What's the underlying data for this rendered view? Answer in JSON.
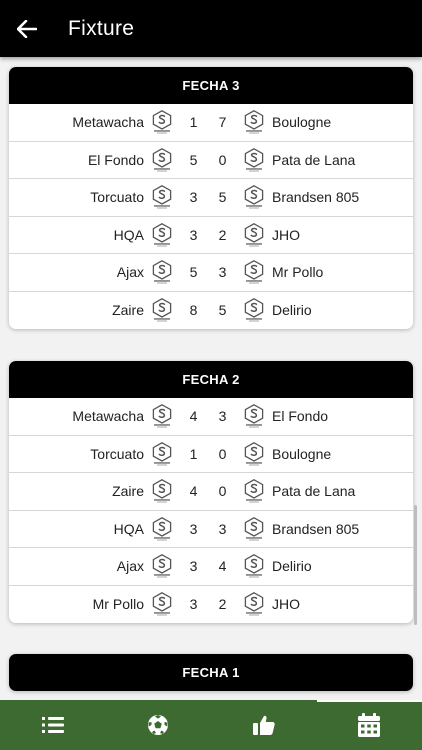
{
  "header": {
    "title": "Fixture"
  },
  "rounds": [
    {
      "label": "FECHA 3",
      "matches": [
        {
          "home": "Metawacha",
          "home_score": "1",
          "away_score": "7",
          "away": "Boulogne"
        },
        {
          "home": "El Fondo",
          "home_score": "5",
          "away_score": "0",
          "away": "Pata de Lana"
        },
        {
          "home": "Torcuato",
          "home_score": "3",
          "away_score": "5",
          "away": "Brandsen 805"
        },
        {
          "home": "HQA",
          "home_score": "3",
          "away_score": "2",
          "away": "JHO"
        },
        {
          "home": "Ajax",
          "home_score": "5",
          "away_score": "3",
          "away": "Mr Pollo"
        },
        {
          "home": "Zaire",
          "home_score": "8",
          "away_score": "5",
          "away": "Delirio"
        }
      ]
    },
    {
      "label": "FECHA 2",
      "matches": [
        {
          "home": "Metawacha",
          "home_score": "4",
          "away_score": "3",
          "away": "El Fondo"
        },
        {
          "home": "Torcuato",
          "home_score": "1",
          "away_score": "0",
          "away": "Boulogne"
        },
        {
          "home": "Zaire",
          "home_score": "4",
          "away_score": "0",
          "away": "Pata de Lana"
        },
        {
          "home": "HQA",
          "home_score": "3",
          "away_score": "3",
          "away": "Brandsen 805"
        },
        {
          "home": "Ajax",
          "home_score": "3",
          "away_score": "4",
          "away": "Delirio"
        },
        {
          "home": "Mr Pollo",
          "home_score": "3",
          "away_score": "2",
          "away": "JHO"
        }
      ]
    },
    {
      "label": "FECHA 1",
      "matches": []
    }
  ],
  "nav": [
    {
      "icon": "list-icon"
    },
    {
      "icon": "soccer-ball-icon"
    },
    {
      "icon": "thumbs-up-icon"
    },
    {
      "icon": "calendar-icon"
    }
  ],
  "colors": {
    "topbar": "#000000",
    "bottombar": "#3c6a31",
    "card_header": "#000000"
  }
}
